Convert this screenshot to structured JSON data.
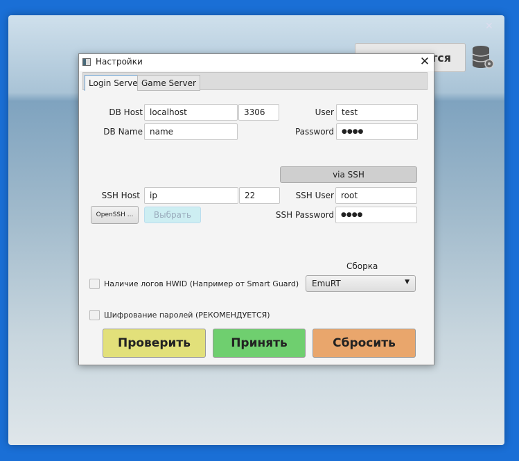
{
  "background": {
    "button_fragment": "тся",
    "close": "✕",
    "icon": "database-settings-icon"
  },
  "dialog": {
    "title": "Настройки",
    "close": "✕",
    "tabs": [
      {
        "label": "Login Server",
        "active": true
      },
      {
        "label": "Game Server",
        "active": false
      }
    ],
    "db": {
      "host_label": "DB Host",
      "host": "localhost",
      "port": "3306",
      "name_label": "DB Name",
      "name": "name",
      "user_label": "User",
      "user": "test",
      "password_label": "Password",
      "password": "●●●●"
    },
    "ssh": {
      "via_ssh": "via SSH",
      "host_label": "SSH Host",
      "host": "ip",
      "port": "22",
      "user_label": "SSH User",
      "user": "root",
      "password_label": "SSH Password",
      "password": "●●●●",
      "openssh": "OpenSSH ...",
      "choose": "Выбрать"
    },
    "build": {
      "label": "Сборка",
      "selected": "EmuRT"
    },
    "hwid": {
      "label": "Наличие логов HWID (Например от Smart Guard)",
      "checked": false
    },
    "encrypt": {
      "label": "Шифрование паролей (РЕКОМЕНДУЕТСЯ)",
      "checked": false
    },
    "buttons": {
      "check": "Проверить",
      "accept": "Принять",
      "reset": "Сбросить"
    },
    "colors": {
      "check": "#e2e07a",
      "accept": "#6fcf6f",
      "reset": "#e9a66c"
    }
  }
}
